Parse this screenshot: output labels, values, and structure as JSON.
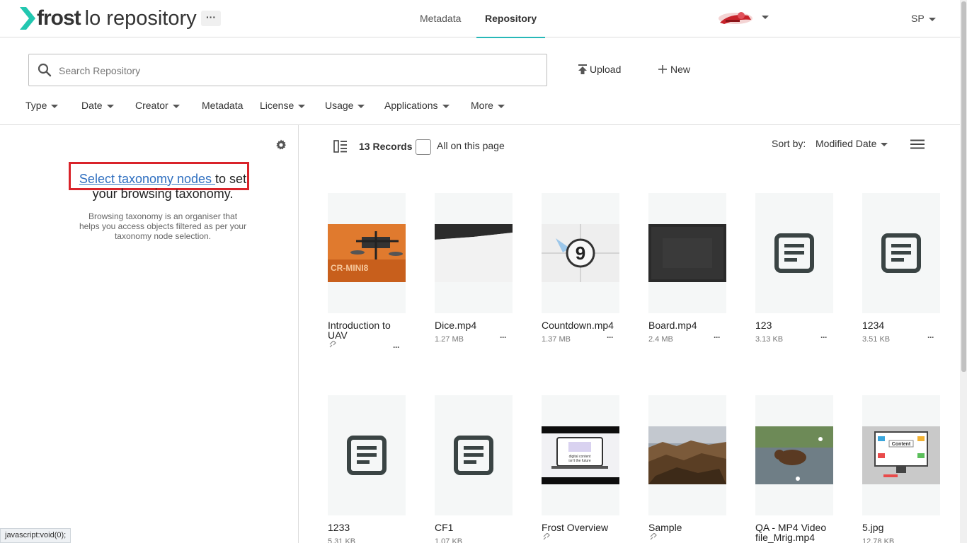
{
  "header": {
    "logo_bold": "frost",
    "logo_rest": "lo repository",
    "more_label": "···",
    "tabs": [
      {
        "label": "Metadata",
        "active": false
      },
      {
        "label": "Repository",
        "active": true
      }
    ],
    "user_initials": "SP",
    "accent_color": "#27b8b8"
  },
  "search": {
    "placeholder": "Search Repository",
    "value": ""
  },
  "actions": {
    "upload_label": "Upload",
    "new_label": "New"
  },
  "filters": [
    "Type",
    "Date",
    "Creator",
    "Metadata",
    "License",
    "Usage",
    "Applications",
    "More"
  ],
  "left_panel": {
    "link_text": "Select taxonomy nodes ",
    "link_suffix": "to set",
    "line2": "your browsing taxonomy.",
    "description": "Browsing taxonomy is an organiser that helps you access objects filtered as per your taxonomy node selection.",
    "highlight_color": "#d9232a"
  },
  "status_bar": "javascript:void(0);",
  "results": {
    "records": "13 Records",
    "all_on_page": "All on this page",
    "sort_label": "Sort by:",
    "sort_value": "Modified Date"
  },
  "tiles": [
    {
      "name": "Introduction to UAV",
      "size": "",
      "thumb": "drone",
      "linked": true
    },
    {
      "name": "Dice.mp4",
      "size": "1.27 MB",
      "thumb": "dice",
      "linked": false
    },
    {
      "name": "Countdown.mp4",
      "size": "1.37 MB",
      "thumb": "countdown",
      "linked": false
    },
    {
      "name": "Board.mp4",
      "size": "2.4 MB",
      "thumb": "board",
      "linked": false
    },
    {
      "name": "123",
      "size": "3.13 KB",
      "thumb": "doc",
      "linked": false
    },
    {
      "name": "1234",
      "size": "3.51 KB",
      "thumb": "doc",
      "linked": false
    },
    {
      "name": "1233",
      "size": "5.31 KB",
      "thumb": "doc",
      "linked": false
    },
    {
      "name": "CF1",
      "size": "1.07 KB",
      "thumb": "doc",
      "linked": false
    },
    {
      "name": "Frost Overview",
      "size": "",
      "thumb": "overview",
      "linked": true
    },
    {
      "name": "Sample",
      "size": "",
      "thumb": "rocks",
      "linked": true
    },
    {
      "name": "QA - MP4 Video file_Mrig.mp4",
      "size": "",
      "thumb": "bear",
      "linked": false
    },
    {
      "name": "5.jpg",
      "size": "12.78 KB",
      "thumb": "content",
      "linked": false
    }
  ]
}
